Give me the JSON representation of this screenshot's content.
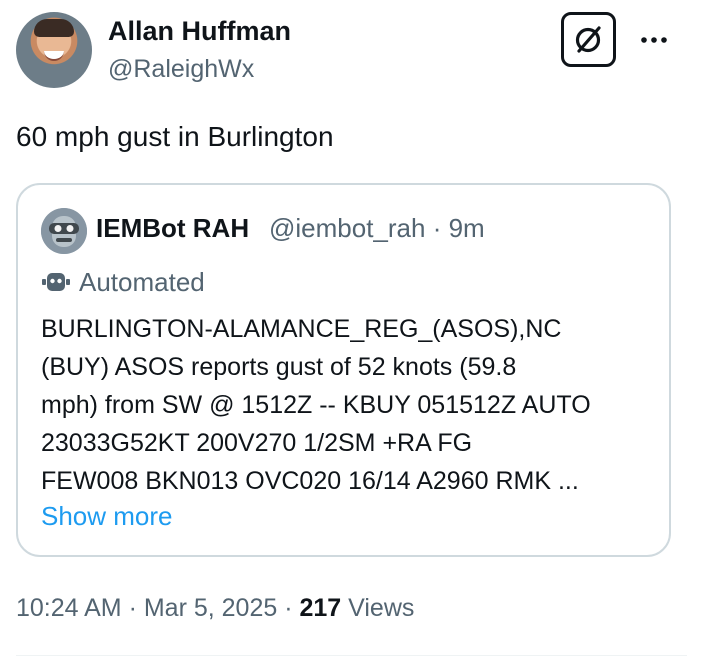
{
  "author": {
    "name": "Allan Huffman",
    "handle": "@RaleighWx"
  },
  "header": {
    "grok_icon": "grok-slash-icon",
    "more_icon": "more-dots-icon"
  },
  "tweet": {
    "text": "60 mph gust in Burlington"
  },
  "quote": {
    "name": "IEMBot RAH",
    "meta": "@iembot_rah · 9m",
    "automated_label": "Automated",
    "automated_icon": "robot-icon",
    "body_lines": [
      "BURLINGTON-ALAMANCE_REG_(ASOS),NC",
      "(BUY) ASOS reports gust of 52 knots (59.8",
      "mph) from SW @ 1512Z -- KBUY 051512Z AUTO",
      "23033G52KT 200V270 1/2SM +RA FG",
      "FEW008 BKN013 OVC020 16/14 A2960 RMK ..."
    ],
    "show_more": "Show more"
  },
  "footer": {
    "time_date": "10:24 AM · Mar 5, 2025 ·",
    "views_count": "217",
    "views_label": "Views"
  },
  "colors": {
    "text": "#0f1419",
    "secondary": "#536471",
    "link": "#1d9bf0",
    "border": "#cfd9de"
  }
}
